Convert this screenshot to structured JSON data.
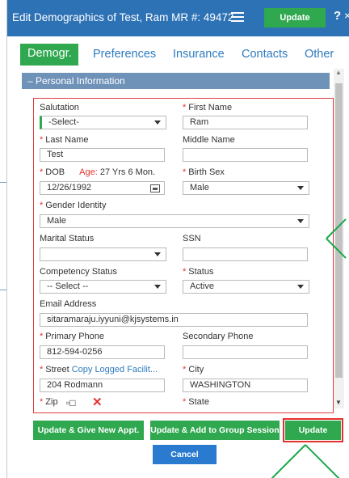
{
  "title": "Edit Demographics of Test, Ram  MR #: 49472",
  "top_update_label": "Update",
  "help_glyph": "?",
  "close_glyph": "×",
  "tabs": [
    {
      "label": "Demogr."
    },
    {
      "label": "Preferences"
    },
    {
      "label": "Insurance"
    },
    {
      "label": "Contacts"
    },
    {
      "label": "Other"
    }
  ],
  "section": {
    "label": "– Personal Information"
  },
  "fields": {
    "salutation": {
      "label": "Salutation",
      "value": "-Select-"
    },
    "first_name": {
      "label": "First Name",
      "value": "Ram"
    },
    "last_name": {
      "label": "Last Name",
      "value": "Test"
    },
    "middle_name": {
      "label": "Middle Name",
      "value": ""
    },
    "dob": {
      "label": "DOB",
      "age_label": "Age:",
      "age_value": "27 Yrs 6 Mon.",
      "value": "12/26/1992"
    },
    "birth_sex": {
      "label": "Birth Sex",
      "value": "Male"
    },
    "gender_identity": {
      "label": "Gender Identity",
      "value": "Male"
    },
    "marital_status": {
      "label": "Marital Status",
      "value": ""
    },
    "ssn": {
      "label": "SSN",
      "value": ""
    },
    "competency_status": {
      "label": "Competency Status",
      "value": "-- Select --"
    },
    "status": {
      "label": "Status",
      "value": "Active"
    },
    "email": {
      "label": "Email Address",
      "value": "sitaramaraju.iyyuni@kjsystems.in"
    },
    "primary_phone": {
      "label": "Primary Phone",
      "value": "812-594-0256"
    },
    "secondary_phone": {
      "label": "Secondary Phone",
      "value": ""
    },
    "street": {
      "label": "Street",
      "link": "Copy Logged Facilit...",
      "value": "204 Rodmann"
    },
    "city": {
      "label": "City",
      "value": "WASHINGTON"
    },
    "zip": {
      "label": "Zip"
    },
    "state": {
      "label": "State"
    }
  },
  "required_mark": "*",
  "buttons": {
    "give_new_appt": "Update & Give New Appt.",
    "add_group": "Update & Add to Group Session",
    "update": "Update",
    "cancel": "Cancel"
  },
  "colors": {
    "titlebar": "#2e72b6",
    "accent_green": "#2fa84f",
    "required_red": "#e2322f",
    "link_blue": "#2e7bbf",
    "section_header": "#6f92b8"
  }
}
